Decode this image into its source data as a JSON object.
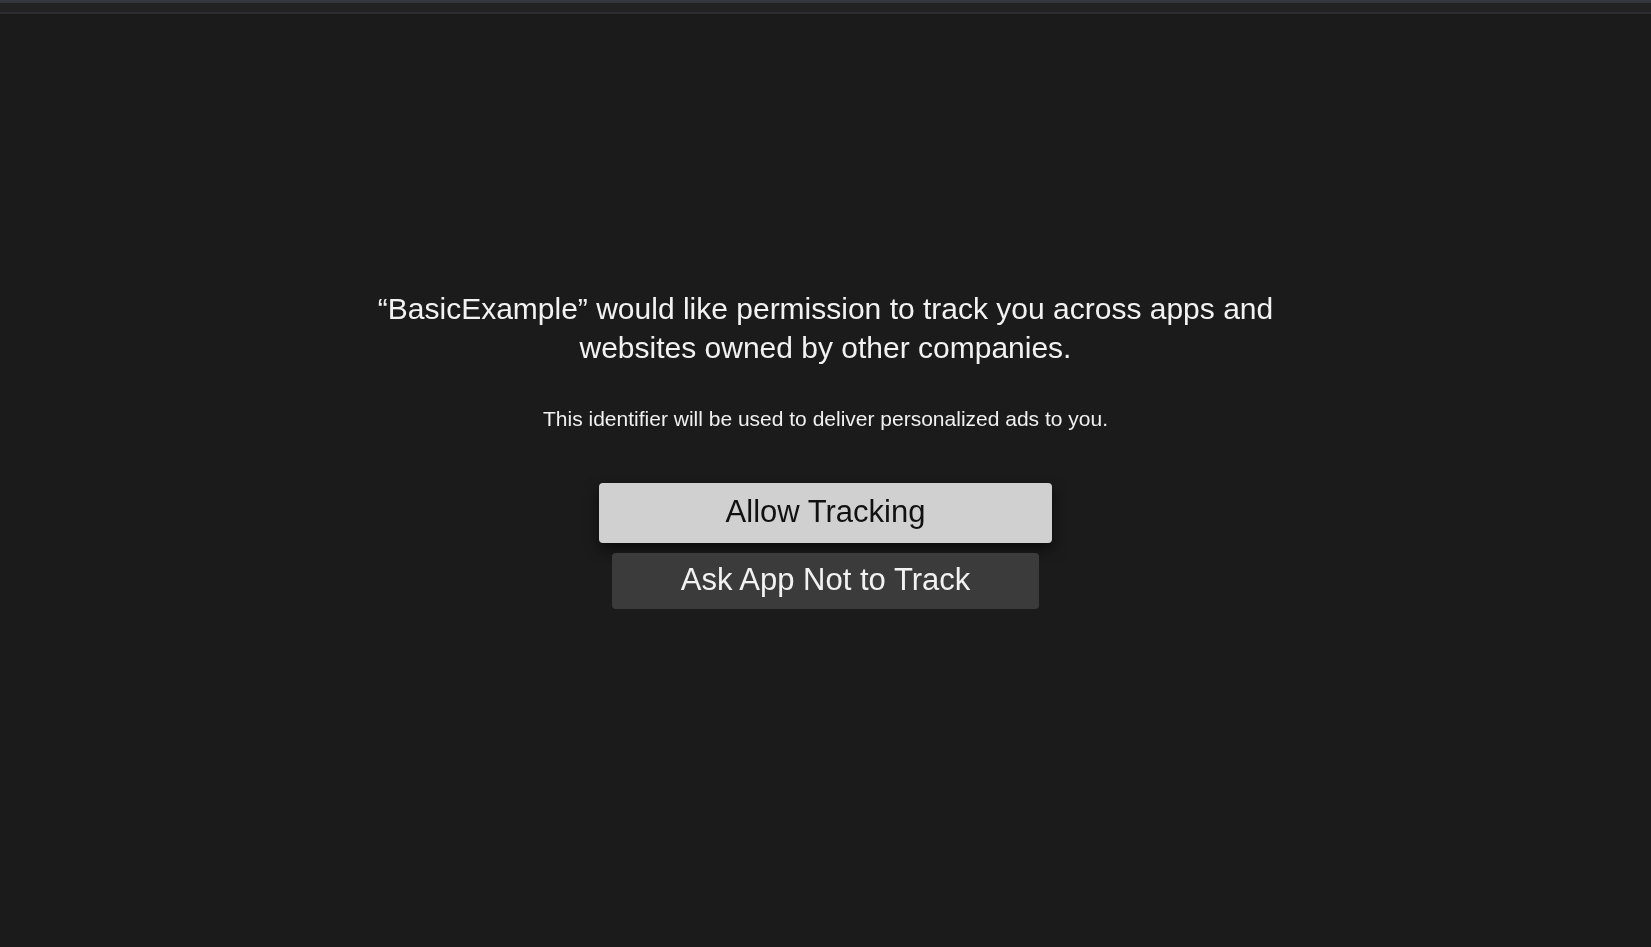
{
  "alert": {
    "title": "“BasicExample” would like permission to track you across apps and websites owned by other companies.",
    "message": "This identifier will be used to deliver personalized ads to you.",
    "buttons": [
      {
        "label": "Allow Tracking",
        "selected": true
      },
      {
        "label": "Ask App Not to Track",
        "selected": false
      }
    ]
  }
}
